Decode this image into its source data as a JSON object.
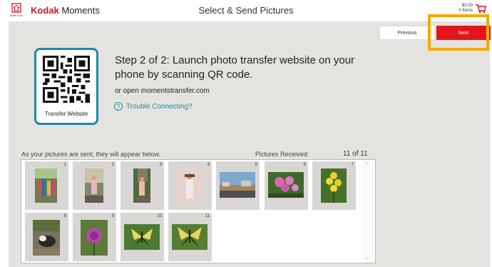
{
  "header": {
    "start_over_label": "Start Over",
    "brand_kodak": "Kodak",
    "brand_moments": "Moments",
    "page_title": "Select & Send Pictures",
    "cart_amount": "$0.00",
    "cart_items": "0 Items"
  },
  "nav": {
    "previous_label": "Previous",
    "next_label": "Next"
  },
  "qr": {
    "caption": "Transfer Website"
  },
  "instructions": {
    "step_title": "Step 2 of 2: Launch photo transfer website on your phone by scanning QR code.",
    "alt_text": "or open momentstransfer.com",
    "trouble_label": "Trouble Connecting?"
  },
  "gallery": {
    "note": "As your pictures are sent, they will appear below.",
    "received_label": "Pictures Received:",
    "received_count": "11 of 11",
    "photos": [
      {
        "number": "1"
      },
      {
        "number": "2"
      },
      {
        "number": "3"
      },
      {
        "number": "4"
      },
      {
        "number": "5"
      },
      {
        "number": "6"
      },
      {
        "number": "7"
      },
      {
        "number": "8"
      },
      {
        "number": "9"
      },
      {
        "number": "10"
      },
      {
        "number": "11"
      }
    ]
  },
  "colors": {
    "brand_red": "#e2151c",
    "accent_teal": "#1e89a4",
    "highlight": "#f6a800"
  }
}
